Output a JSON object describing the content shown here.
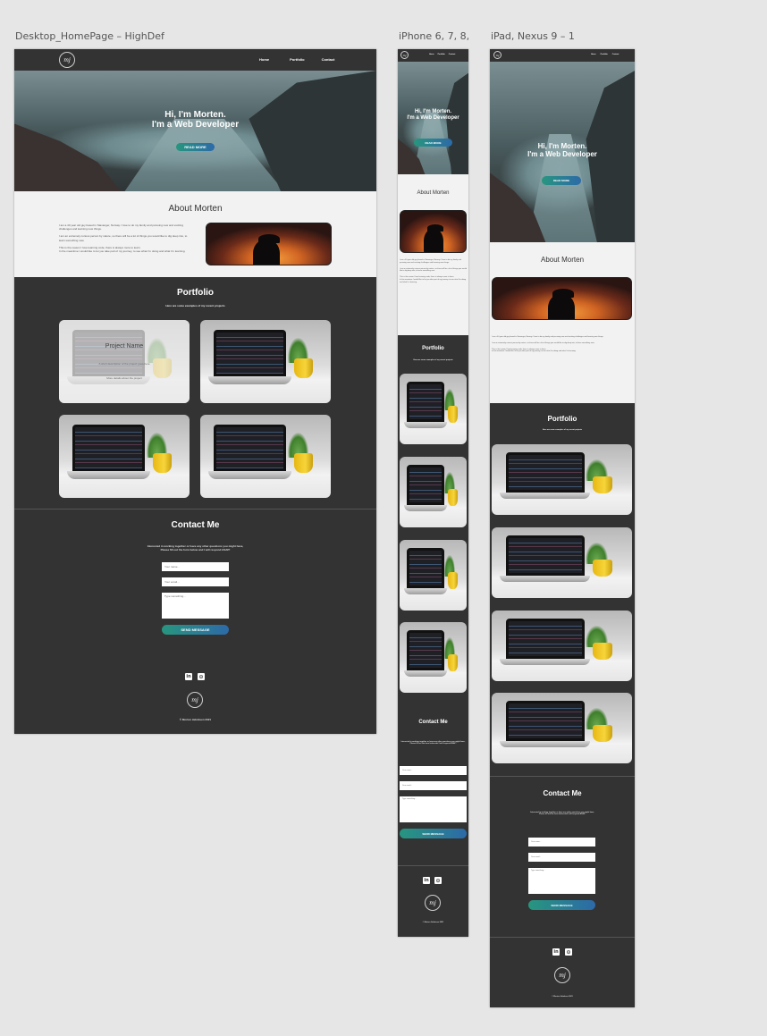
{
  "artboards": {
    "desktop": "Desktop_HomePage – HighDef",
    "iphone": "iPhone 6, 7, 8, ...",
    "ipad": "iPad, Nexus 9 – 1"
  },
  "nav": {
    "logo": "mj",
    "home": "Home",
    "portfolio": "Portfolio",
    "contact": "Contact"
  },
  "hero": {
    "line1": "Hi, I'm Morten.",
    "line2": "I'm a Web Developer",
    "button": "READ MORE"
  },
  "about": {
    "title": "About Morten",
    "paragraphs": [
      "I am a 40 year old guy based in Stavanger, Norway. I love to do my family and pursuing new and exciting challenges and learning new things.",
      "I am an extremely curious person by nature, so there will be a lot of things you would like to dig deep into, to learn something new.",
      "This is the reason I love learning code, there is always more to learn.",
      "In the meantime I would like to let you take part of my journey, to see what I'm doing and what I'm learning."
    ]
  },
  "portfolio": {
    "title": "Portfolio",
    "subtitle": "Here are some examples of my recent projects",
    "overlay": {
      "name": "Project Name",
      "line1": "A short description of the project goes here",
      "line2": "More details about the project"
    }
  },
  "contact": {
    "title": "Contact Me",
    "line1": "Interested in working together or have any other questions you might have,",
    "line2": "Please fill out the form below and I will respond ASAP!",
    "name_placeholder": "Your name...",
    "email_placeholder": "Your email...",
    "message_placeholder": "Type something...",
    "button": "SEND MESSAGE"
  },
  "footer": {
    "linkedin": "in",
    "github": "⊙",
    "logo": "mj",
    "copyright": "© Morten Jakobsen 2021"
  },
  "colors": {
    "dark": "#333333",
    "light": "#f2f2f2",
    "gradient_start": "#27967f",
    "gradient_end": "#2d6aa8"
  }
}
